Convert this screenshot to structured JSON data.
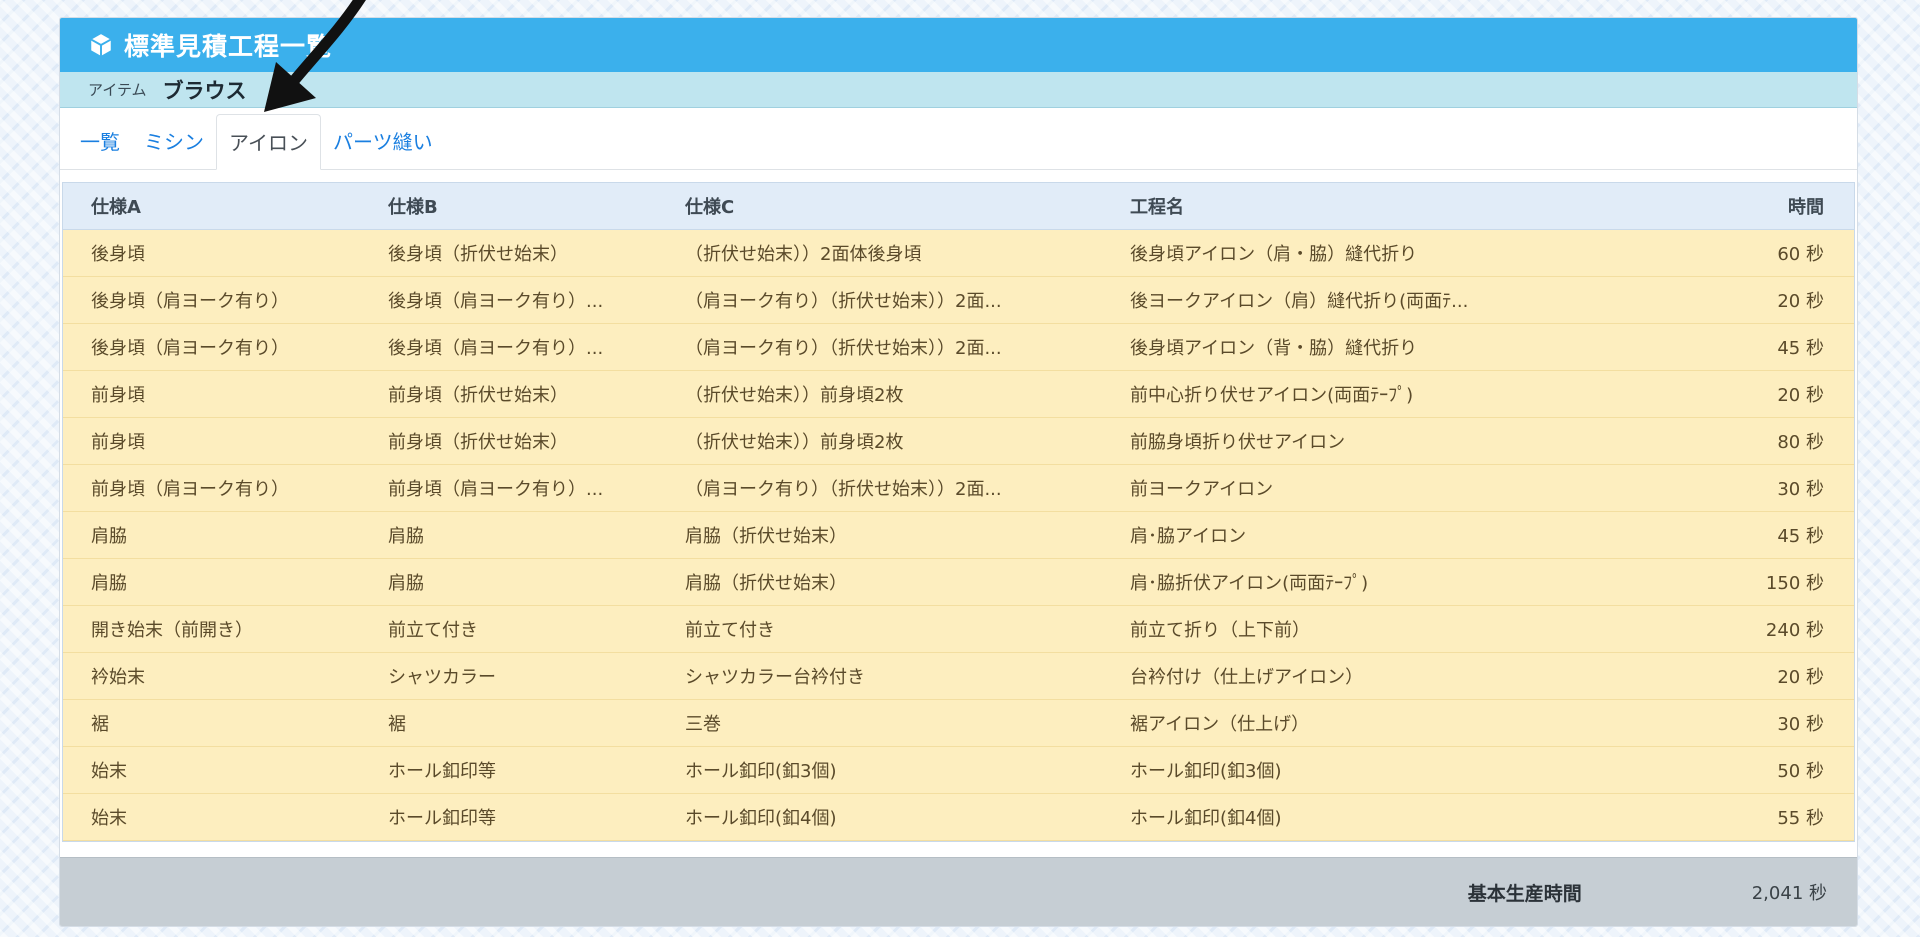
{
  "header": {
    "title": "標準見積工程一覧"
  },
  "item": {
    "label": "アイテム",
    "value": "ブラウス"
  },
  "tabs": [
    {
      "label": "一覧",
      "active": false
    },
    {
      "label": "ミシン",
      "active": false
    },
    {
      "label": "アイロン",
      "active": true
    },
    {
      "label": "パーツ縫い",
      "active": false
    }
  ],
  "table": {
    "headers": {
      "spec_a": "仕様A",
      "spec_b": "仕様B",
      "spec_c": "仕様C",
      "process": "工程名",
      "time": "時間"
    },
    "rows": [
      {
        "spec_a": "後身頃",
        "spec_b": "後身頃（折伏せ始末）",
        "spec_c": "（折伏せ始末））2面体後身頃",
        "process": "後身頃アイロン（肩・脇）縫代折り",
        "time": "60 秒"
      },
      {
        "spec_a": "後身頃（肩ヨーク有り）",
        "spec_b": "後身頃（肩ヨーク有り）...",
        "spec_c": "（肩ヨーク有り）（折伏せ始末））2面...",
        "process": "後ヨークアイロン（肩）縫代折り(両面ﾃ...",
        "time": "20 秒"
      },
      {
        "spec_a": "後身頃（肩ヨーク有り）",
        "spec_b": "後身頃（肩ヨーク有り）...",
        "spec_c": "（肩ヨーク有り）（折伏せ始末））2面...",
        "process": "後身頃アイロン（背・脇）縫代折り",
        "time": "45 秒"
      },
      {
        "spec_a": "前身頃",
        "spec_b": "前身頃（折伏せ始末）",
        "spec_c": "（折伏せ始末））前身頃2枚",
        "process": "前中心折り伏せアイロン(両面ﾃｰﾌﾟ)",
        "time": "20 秒"
      },
      {
        "spec_a": "前身頃",
        "spec_b": "前身頃（折伏せ始末）",
        "spec_c": "（折伏せ始末））前身頃2枚",
        "process": "前脇身頃折り伏せアイロン",
        "time": "80 秒"
      },
      {
        "spec_a": "前身頃（肩ヨーク有り）",
        "spec_b": "前身頃（肩ヨーク有り）...",
        "spec_c": "（肩ヨーク有り）（折伏せ始末））2面...",
        "process": "前ヨークアイロン",
        "time": "30 秒"
      },
      {
        "spec_a": "肩脇",
        "spec_b": "肩脇",
        "spec_c": "肩脇（折伏せ始末）",
        "process": "肩･脇アイロン",
        "time": "45 秒"
      },
      {
        "spec_a": "肩脇",
        "spec_b": "肩脇",
        "spec_c": "肩脇（折伏せ始末）",
        "process": "肩･脇折伏アイロン(両面ﾃｰﾌﾟ)",
        "time": "150 秒"
      },
      {
        "spec_a": "開き始末（前開き）",
        "spec_b": "前立て付き",
        "spec_c": "前立て付き",
        "process": "前立て折り（上下前）",
        "time": "240 秒"
      },
      {
        "spec_a": "衿始末",
        "spec_b": "シャツカラー",
        "spec_c": "シャツカラー台衿付き",
        "process": "台衿付け（仕上げアイロン）",
        "time": "20 秒"
      },
      {
        "spec_a": "裾",
        "spec_b": "裾",
        "spec_c": "三巻",
        "process": "裾アイロン（仕上げ）",
        "time": "30 秒"
      },
      {
        "spec_a": "始末",
        "spec_b": "ホール釦印等",
        "spec_c": "ホール釦印(釦3個)",
        "process": "ホール釦印(釦3個)",
        "time": "50 秒"
      },
      {
        "spec_a": "始末",
        "spec_b": "ホール釦印等",
        "spec_c": "ホール釦印(釦4個)",
        "process": "ホール釦印(釦4個)",
        "time": "55 秒"
      }
    ]
  },
  "footer": {
    "label": "基本生産時間",
    "value": "2,041 秒"
  },
  "colors": {
    "header_bg": "#3bb0ec",
    "item_bar_bg": "#bfe5ef",
    "row_bg": "#fdeebf",
    "table_head_bg": "#e1ecf8",
    "tab_link": "#1a7fe0",
    "footer_bg": "#c6ced4"
  },
  "icons": {
    "header": "cube-icon",
    "annotation": "curved-arrow-icon"
  }
}
